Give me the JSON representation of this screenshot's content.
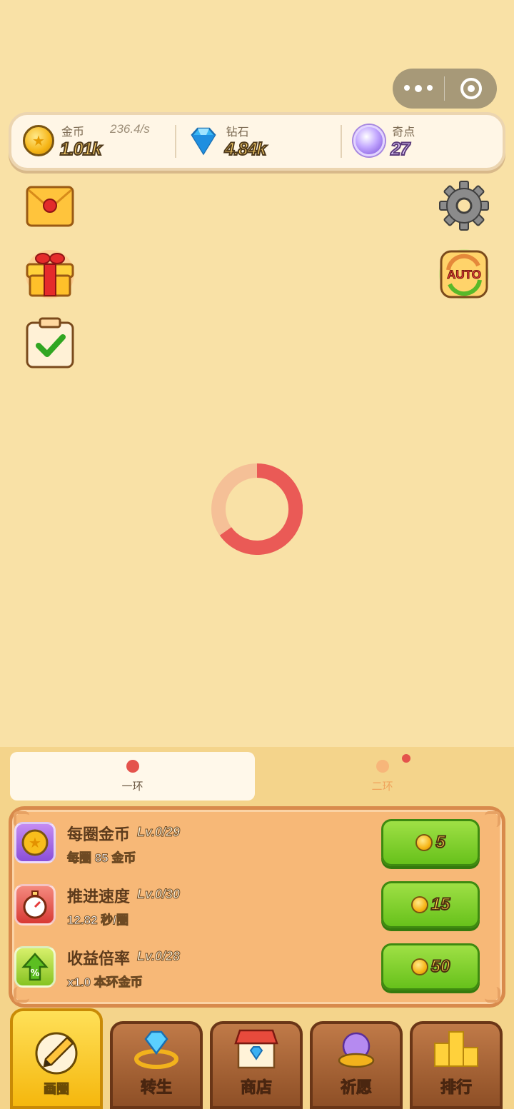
{
  "resources": {
    "gold": {
      "label": "金币",
      "value": "1.01k",
      "rate": "236.4/s"
    },
    "diamond": {
      "label": "钻石",
      "value": "4.84k"
    },
    "points": {
      "label": "奇点",
      "value": "27"
    }
  },
  "tabs": [
    {
      "label": "一环",
      "active": true
    },
    {
      "label": "二环",
      "active": false
    }
  ],
  "upgrades": [
    {
      "name": "每圈金币",
      "level": "Lv.0/29",
      "desc": "每圈 85 金币",
      "cost": "5",
      "icon": "coin-star-icon"
    },
    {
      "name": "推进速度",
      "level": "Lv.0/30",
      "desc": "12.82 秒/圈",
      "cost": "15",
      "icon": "stopwatch-icon"
    },
    {
      "name": "收益倍率",
      "level": "Lv.0/28",
      "desc": "x1.0 本环金币",
      "cost": "50",
      "icon": "percent-arrow-icon"
    }
  ],
  "nav": [
    {
      "label": "画圈",
      "icon": "pencil-icon",
      "active": true
    },
    {
      "label": "转生",
      "icon": "diamond-ring-icon",
      "active": false
    },
    {
      "label": "商店",
      "icon": "shop-icon",
      "active": false
    },
    {
      "label": "祈愿",
      "icon": "crystal-orb-icon",
      "active": false
    },
    {
      "label": "排行",
      "icon": "podium-icon",
      "active": false
    }
  ],
  "colors": {
    "background": "#f9e1a6",
    "accent_red": "#e4534c",
    "button_green": "#7fd030",
    "nav_active": "#f5c020",
    "nav_brown": "#a8612f"
  }
}
